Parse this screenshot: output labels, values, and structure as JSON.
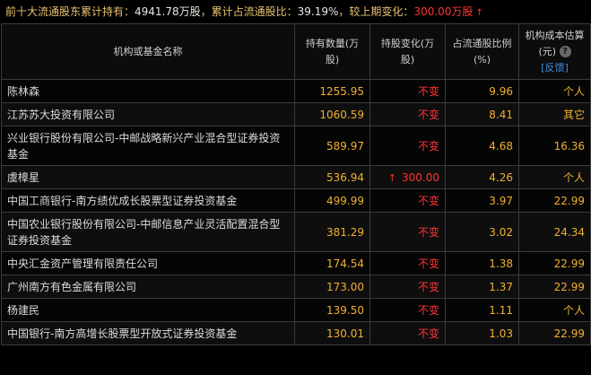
{
  "summary": {
    "label1": "前十大流通股东累计持有：",
    "total_hold": "4941.78万股",
    "label2": "，累计占流通股比：",
    "total_ratio": "39.19%",
    "label3": "，较上期变化：",
    "change": "300.00万股",
    "change_arrow": "↑"
  },
  "table": {
    "headers": {
      "name": "机构或基金名称",
      "qty": "持有数量(万股)",
      "chg": "持股变化(万股)",
      "pct": "占流通股比例(%)",
      "cost": "机构成本估算(元)",
      "help_icon": "?",
      "feedback": "[反馈]"
    },
    "rows": [
      {
        "name": "陈林森",
        "qty": "1255.95",
        "chg": "不变",
        "pct": "9.96",
        "cost": "个人"
      },
      {
        "name": "江苏苏大投资有限公司",
        "qty": "1060.59",
        "chg": "不变",
        "pct": "8.41",
        "cost": "其它"
      },
      {
        "name": "兴业银行股份有限公司-中邮战略新兴产业混合型证券投资基金",
        "qty": "589.97",
        "chg": "不变",
        "pct": "4.68",
        "cost": "16.36"
      },
      {
        "name": "虞樟星",
        "qty": "536.94",
        "chg": "300.00",
        "chg_arrow": "↑",
        "pct": "4.26",
        "cost": "个人"
      },
      {
        "name": "中国工商银行-南方绩优成长股票型证券投资基金",
        "qty": "499.99",
        "chg": "不变",
        "pct": "3.97",
        "cost": "22.99"
      },
      {
        "name": "中国农业银行股份有限公司-中邮信息产业灵活配置混合型证券投资基金",
        "qty": "381.29",
        "chg": "不变",
        "pct": "3.02",
        "cost": "24.34"
      },
      {
        "name": "中央汇金资产管理有限责任公司",
        "qty": "174.54",
        "chg": "不变",
        "pct": "1.38",
        "cost": "22.99"
      },
      {
        "name": "广州南方有色金属有限公司",
        "qty": "173.00",
        "chg": "不变",
        "pct": "1.37",
        "cost": "22.99"
      },
      {
        "name": "杨建民",
        "qty": "139.50",
        "chg": "不变",
        "pct": "1.11",
        "cost": "个人"
      },
      {
        "name": "中国银行-南方高增长股票型开放式证券投资基金",
        "qty": "130.01",
        "chg": "不变",
        "pct": "1.03",
        "cost": "22.99"
      }
    ]
  }
}
